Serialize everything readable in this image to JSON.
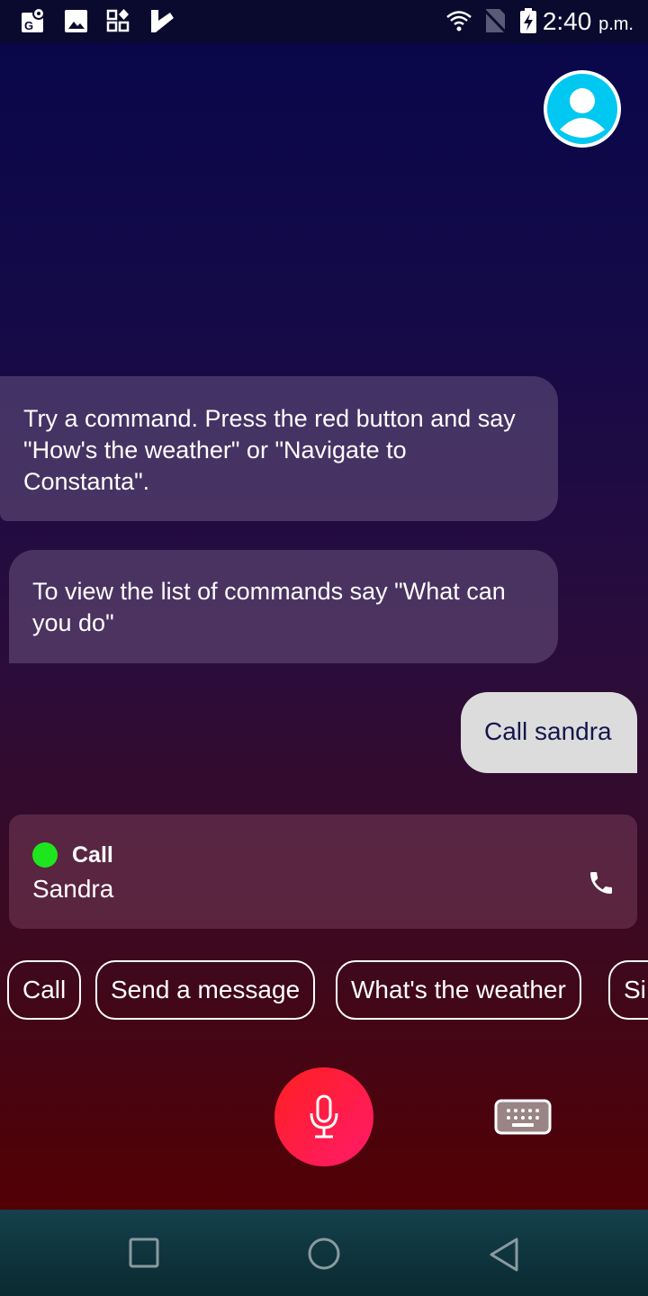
{
  "status_bar": {
    "time": "2:40",
    "ampm": "p.m.",
    "left_icons": [
      "maps-icon",
      "image-icon",
      "apps-icon",
      "tasks-icon"
    ],
    "right_icons": [
      "wifi-icon",
      "no-sim-icon",
      "battery-charging-icon"
    ]
  },
  "profile": {
    "icon": "user-avatar-icon",
    "color": "#00c8f0"
  },
  "messages": [
    {
      "from": "assistant",
      "text": "Try a command. Press the red button and say \"How's the weather\" or \"Navigate to Constanta\"."
    },
    {
      "from": "assistant",
      "text": "To view the list of commands say \"What can you do\""
    },
    {
      "from": "user",
      "text": "Call sandra"
    }
  ],
  "call_card": {
    "title": "Call",
    "name": "Sandra",
    "status_color": "#1ee61e",
    "icon": "phone-icon"
  },
  "suggestions": [
    "Call",
    "Send a message",
    "What's the weather",
    "Si"
  ],
  "mic_button": {
    "icon": "microphone-icon",
    "color": "#ff2040"
  },
  "keyboard_button": {
    "icon": "keyboard-icon"
  },
  "nav_bar": [
    "recents-button",
    "home-button",
    "back-button"
  ]
}
